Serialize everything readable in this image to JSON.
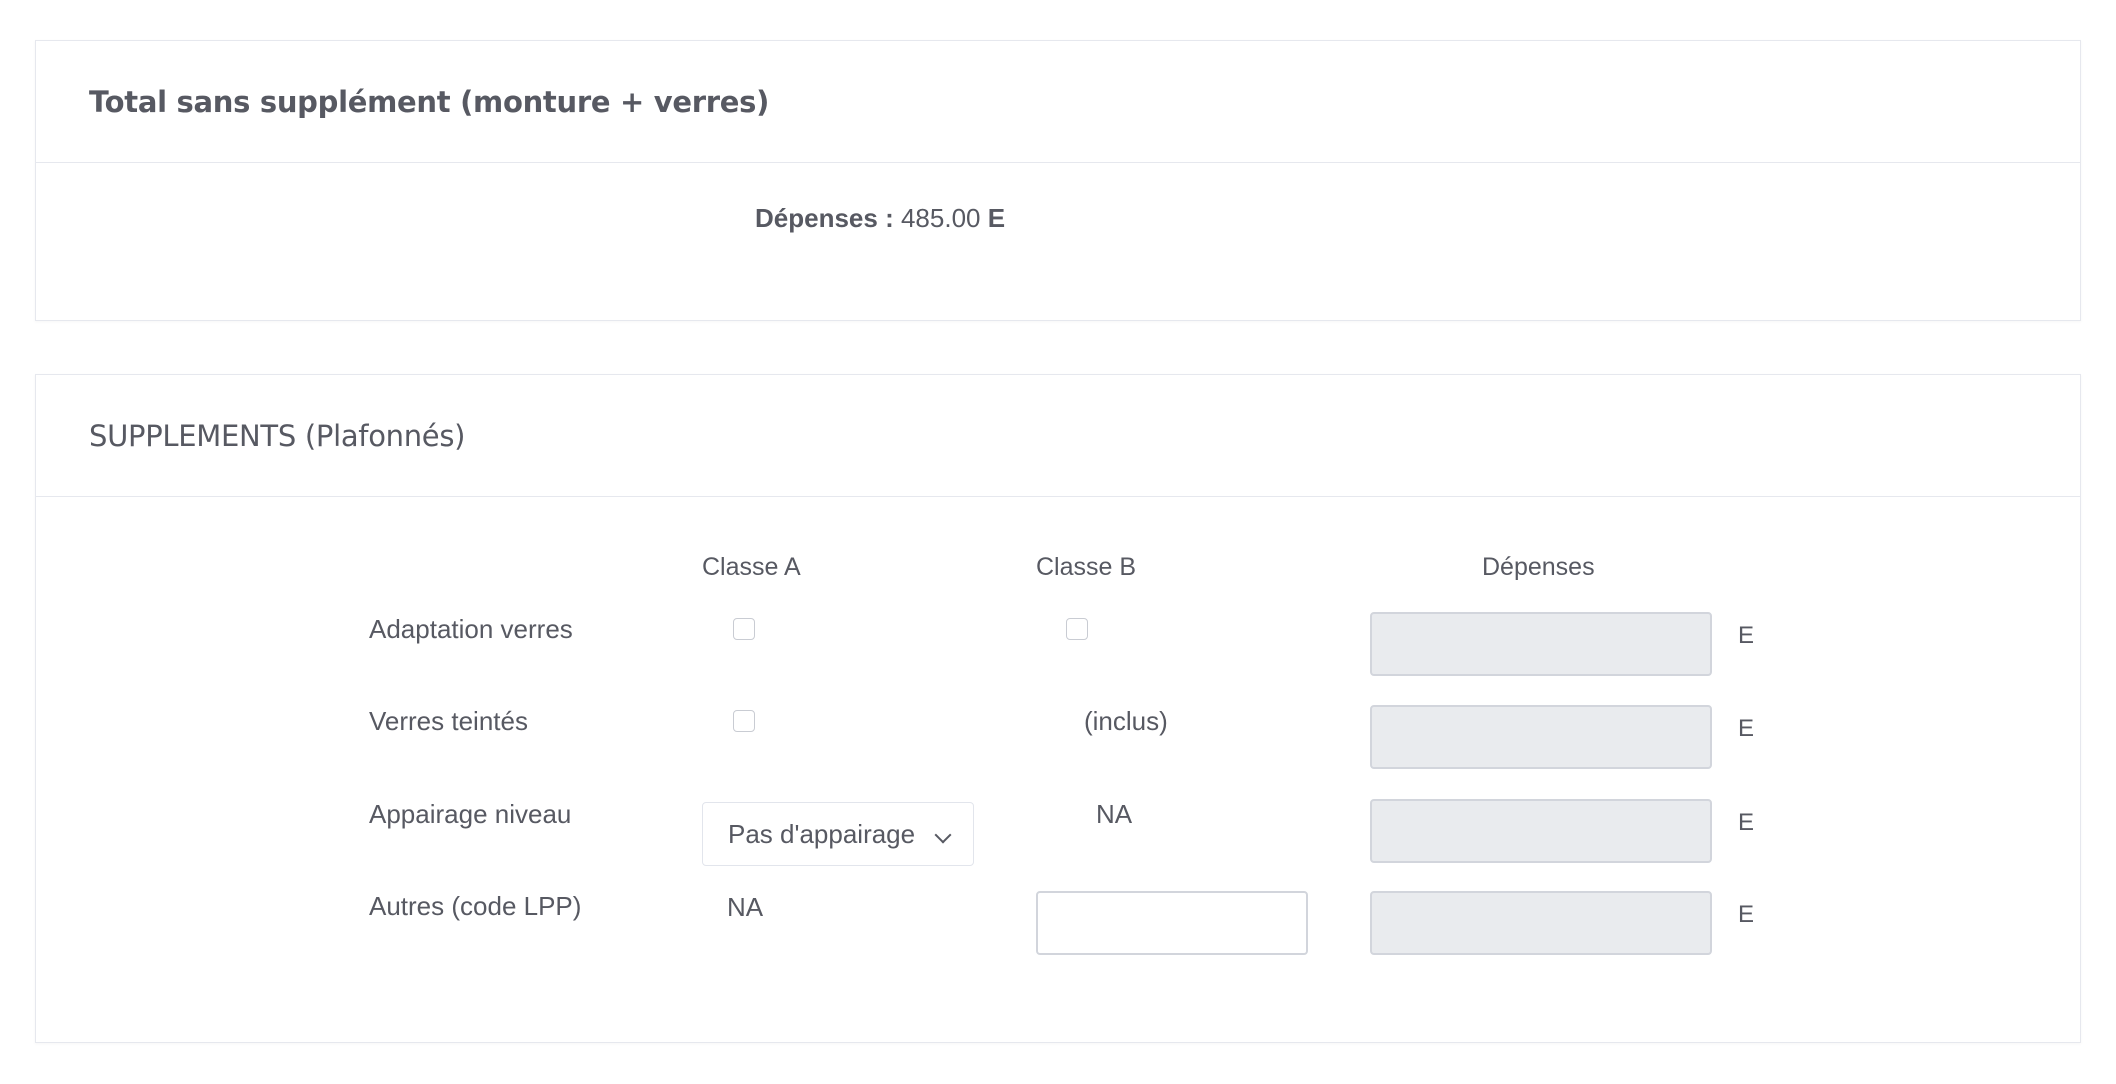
{
  "total_card": {
    "title": "Total sans supplément (monture + verres)",
    "depenses_label": "Dépenses :",
    "depenses_value": "485.00",
    "currency": "E"
  },
  "supplements_card": {
    "title": "SUPPLEMENTS (Plafonnés)",
    "columns": {
      "classe_a": "Classe A",
      "classe_b": "Classe B",
      "depenses": "Dépenses"
    },
    "rows": [
      {
        "label": "Adaptation verres",
        "currency": "E"
      },
      {
        "label": "Verres teintés",
        "classe_b_text": "(inclus)",
        "currency": "E"
      },
      {
        "label": "Appairage niveau",
        "classe_a_select": "Pas d'appairage",
        "classe_b_text": "NA",
        "currency": "E"
      },
      {
        "label": "Autres (code LPP)",
        "classe_a_text": "NA",
        "classe_b_input_value": "",
        "currency": "E"
      }
    ]
  },
  "colors": {
    "text": "#575962",
    "border": "#e6e8ee",
    "disabled_field": "#e9ebee"
  }
}
